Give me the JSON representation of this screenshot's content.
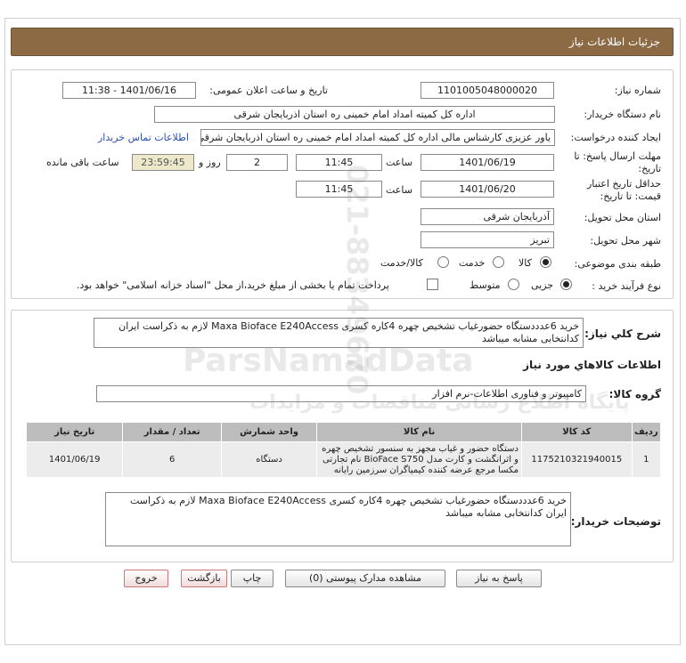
{
  "header": {
    "title": "جزئیات اطلاعات نیاز"
  },
  "form": {
    "need_number_label": "شماره نیاز:",
    "need_number": "1101005048000020",
    "announce_label": "تاریخ و ساعت اعلان عمومی:",
    "announce_value": "1401/06/16 - 11:38",
    "buyer_label": "نام دستگاه خریدار:",
    "buyer_value": "اداره کل کمیته امداد امام خمینی  ره  استان اذربایجان شرقی",
    "creator_label": "ایجاد کننده درخواست:",
    "creator_value": "یاور عزیزی کارشناس مالی اداره کل کمیته امداد امام خمینی  ره  استان اذربایجان شرقی",
    "contact_link": "اطلاعات تماس خریدار",
    "deadline_label_1": "مهلت ارسال پاسخ: تا",
    "deadline_label_2": "تاریخ:",
    "deadline_date": "1401/06/19",
    "time_label": "ساعت",
    "deadline_time": "11:45",
    "days_value": "2",
    "days_label": "روز و",
    "remaining_time": "23:59:45",
    "remaining_label": "ساعت باقی مانده",
    "validity_label_1": "حداقل تاریخ اعتبار",
    "validity_label_2": "قیمت: تا تاریخ:",
    "validity_date": "1401/06/20",
    "validity_time": "11:45",
    "province_label": "استان محل تحویل:",
    "province_value": "آذربایجان شرقی",
    "city_label": "شهر محل تحویل:",
    "city_value": "تبریز",
    "category_label": "طبقه بندی موضوعی:",
    "category_options": [
      "کالا",
      "خدمت",
      "کالا/خدمت"
    ],
    "category_selected": "کالا",
    "process_label": "نوع فرآیند خرید :",
    "process_options": [
      "جزیی",
      "متوسط"
    ],
    "process_selected": "جزیی",
    "payment_note": "پرداخت تمام یا بخشی از مبلغ خرید،از محل \"اسناد خزانه اسلامی\" خواهد بود."
  },
  "summary": {
    "general_desc_label": "شرح كلي نياز:",
    "general_desc": "خرید 6عدددستگاه حضورغیاب تشخیص چهره 4کاره کسری Maxa Bioface E240Access لازم به ذکراست ایران کدانتخابی مشابه میباشد",
    "goods_info_title": "اطلاعات کالاهاي مورد نياز",
    "goods_group_label": "گروه کالا:",
    "goods_group_value": "کامپیوتر و فناوری اطلاعات-نرم افزار"
  },
  "table": {
    "headers": [
      "ردیف",
      "کد کالا",
      "نام کالا",
      "واحد شمارش",
      "تعداد / مقدار",
      "تاریخ نیاز"
    ],
    "rows": [
      {
        "row": "1",
        "code": "1175210321940015",
        "name": "دستگاه حضور و غیاب مجهز به سنسور تشخیص چهره و اثرانگشت و کارت مدل BioFace S750 نام تجارتی مکسا مرجع عرضه کننده کیمیاگران سرزمین رایانه",
        "unit": "دستگاه",
        "qty": "6",
        "date": "1401/06/19"
      }
    ]
  },
  "buyer_notes": {
    "label": "توضیحات خریدار:",
    "text": "خرید 6عدددستگاه حضورغیاب تشخیص چهره 4کاره کسری Maxa Bioface E240Access لازم به ذکراست ایران کدانتخابی مشابه میباشد"
  },
  "buttons": {
    "reply": "پاسخ به نیاز",
    "docs": "مشاهده مدارک پیوستی (0)",
    "print": "چاپ",
    "back": "بازگشت",
    "exit": "خروج"
  },
  "watermark": {
    "line1": "ParsNamadData",
    "line2": "پایگاه اطلاع رسانی مناقصات و مزایدات",
    "line3": "021-88349670"
  }
}
